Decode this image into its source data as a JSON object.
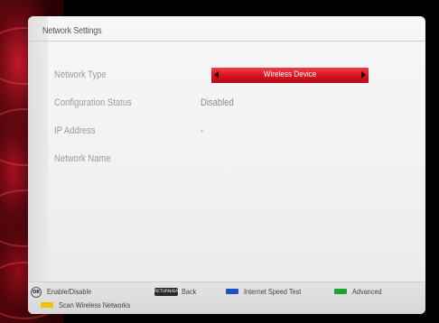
{
  "panel": {
    "title": "Network Settings"
  },
  "rows": [
    {
      "label": "Network Type",
      "value": "Wireless Device",
      "type": "selector"
    },
    {
      "label": "Configuration Status",
      "value": "Disabled",
      "type": "text"
    },
    {
      "label": "IP Address",
      "value": "-",
      "type": "text"
    },
    {
      "label": "Network Name",
      "value": "",
      "type": "text"
    }
  ],
  "footer": {
    "ok": {
      "icon": "ok-button-icon",
      "label": "Enable/Disable"
    },
    "return": {
      "icon_text": "RETURN/BACK",
      "label": "Back"
    },
    "blue": {
      "color": "#1f4fbf",
      "label": "Internet Speed Test"
    },
    "green": {
      "color": "#1f9e3a",
      "label": "Advanced"
    },
    "yellow": {
      "color": "#f2c200",
      "label": "Scan Wireless Networks"
    }
  },
  "colors": {
    "selector": "#d41220",
    "accent_deco": "#b0101e"
  }
}
